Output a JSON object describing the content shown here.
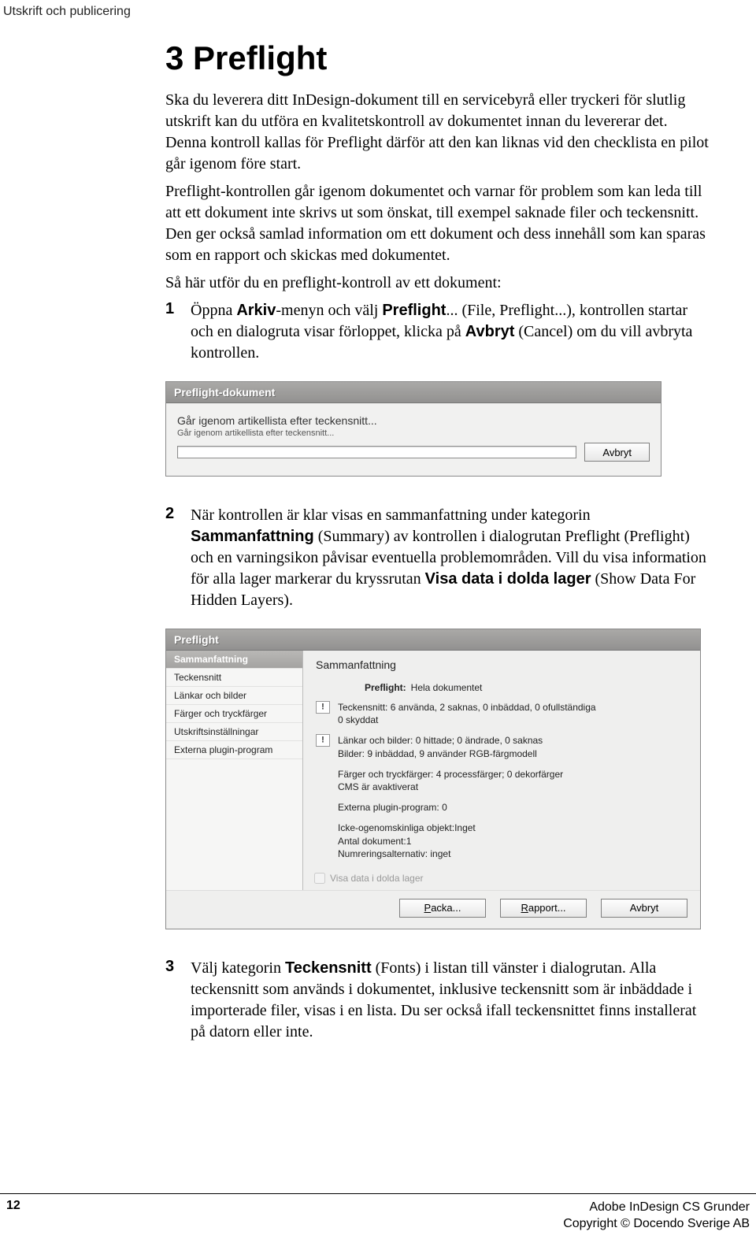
{
  "header": {
    "title": "Utskrift och publicering"
  },
  "section": {
    "heading": "3 Preflight",
    "p1": "Ska du leverera ditt InDesign-dokument till en servicebyrå eller tryckeri för slutlig utskrift kan du utföra en kvalitetskontroll av dokumentet innan du levererar det. Denna kontroll kallas för Preflight därför att den kan liknas vid den checklista en pilot går igenom före start.",
    "p2": "Preflight-kontrollen går igenom dokumentet och varnar för problem som kan leda till att ett dokument inte skrivs ut som önskat, till exempel saknade filer och teckensnitt. Den ger också samlad information om ett dokument och dess innehåll som kan sparas som en rapport och skickas med dokumentet.",
    "p3": "Så här utför du en preflight-kontroll av ett dokument:"
  },
  "step1": {
    "num": "1",
    "pre": "Öppna ",
    "bold1": "Arkiv",
    "mid1": "-menyn och välj ",
    "bold2": "Preflight",
    "mid2": "... (File, Preflight...), kontrollen startar och en dialogruta visar förloppet, klicka på ",
    "bold3": "Avbryt",
    "tail": " (Cancel) om du vill avbryta kontrollen."
  },
  "dialog1": {
    "title": "Preflight-dokument",
    "line1": "Går igenom artikellista efter teckensnitt...",
    "line2": "Går igenom artikellista efter teckensnitt...",
    "cancel": "Avbryt"
  },
  "step2": {
    "num": "2",
    "pre": "När kontrollen är klar visas en sammanfattning under kategorin ",
    "bold1": "Sammanfattning",
    "mid1": " (Summary) av kontrollen i dialogrutan Preflight (Preflight) och en varningsikon påvisar eventuella problemområden. Vill du visa information för alla lager markerar du kryssrutan ",
    "bold2": "Visa data i dolda lager",
    "tail": " (Show Data For Hidden Layers)."
  },
  "dialog2": {
    "title": "Preflight",
    "sidebar": [
      "Sammanfattning",
      "Teckensnitt",
      "Länkar och bilder",
      "Färger och tryckfärger",
      "Utskriftsinställningar",
      "Externa plugin-program"
    ],
    "main_title": "Sammanfattning",
    "pf_label": "Preflight:",
    "pf_value": "Hela dokumentet",
    "warn1a": "Teckensnitt: 6 använda, 2 saknas, 0 inbäddad, 0 ofullständiga",
    "warn1b": "0 skyddat",
    "warn2a": "Länkar och bilder: 0 hittade; 0 ändrade, 0 saknas",
    "warn2b": "Bilder: 9 inbäddad, 9 använder RGB-färgmodell",
    "block3a": "Färger och tryckfärger: 4 processfärger; 0 dekorfärger",
    "block3b": "CMS är avaktiverat",
    "block4": "Externa plugin-program: 0",
    "block5a": "Icke-ogenomskinliga objekt:Inget",
    "block5b": "Antal dokument:1",
    "block5c": "Numreringsalternativ: inget",
    "checkbox": "Visa data i dolda lager",
    "buttons": {
      "packa": "Packa...",
      "rapport": "Rapport...",
      "avbryt": "Avbryt"
    },
    "accel": {
      "packa": "P",
      "rapport": "R"
    }
  },
  "step3": {
    "num": "3",
    "pre": "Välj kategorin ",
    "bold1": "Teckensnitt",
    "tail": " (Fonts) i listan till vänster i dialogrutan. Alla teckensnitt som används i dokumentet, inklusive teckensnitt som är inbäddade i importerade filer, visas i en lista. Du ser också ifall teckensnittet finns installerat på datorn eller inte."
  },
  "footer": {
    "page": "12",
    "r1": "Adobe InDesign CS Grunder",
    "r2": "Copyright © Docendo Sverige AB"
  }
}
